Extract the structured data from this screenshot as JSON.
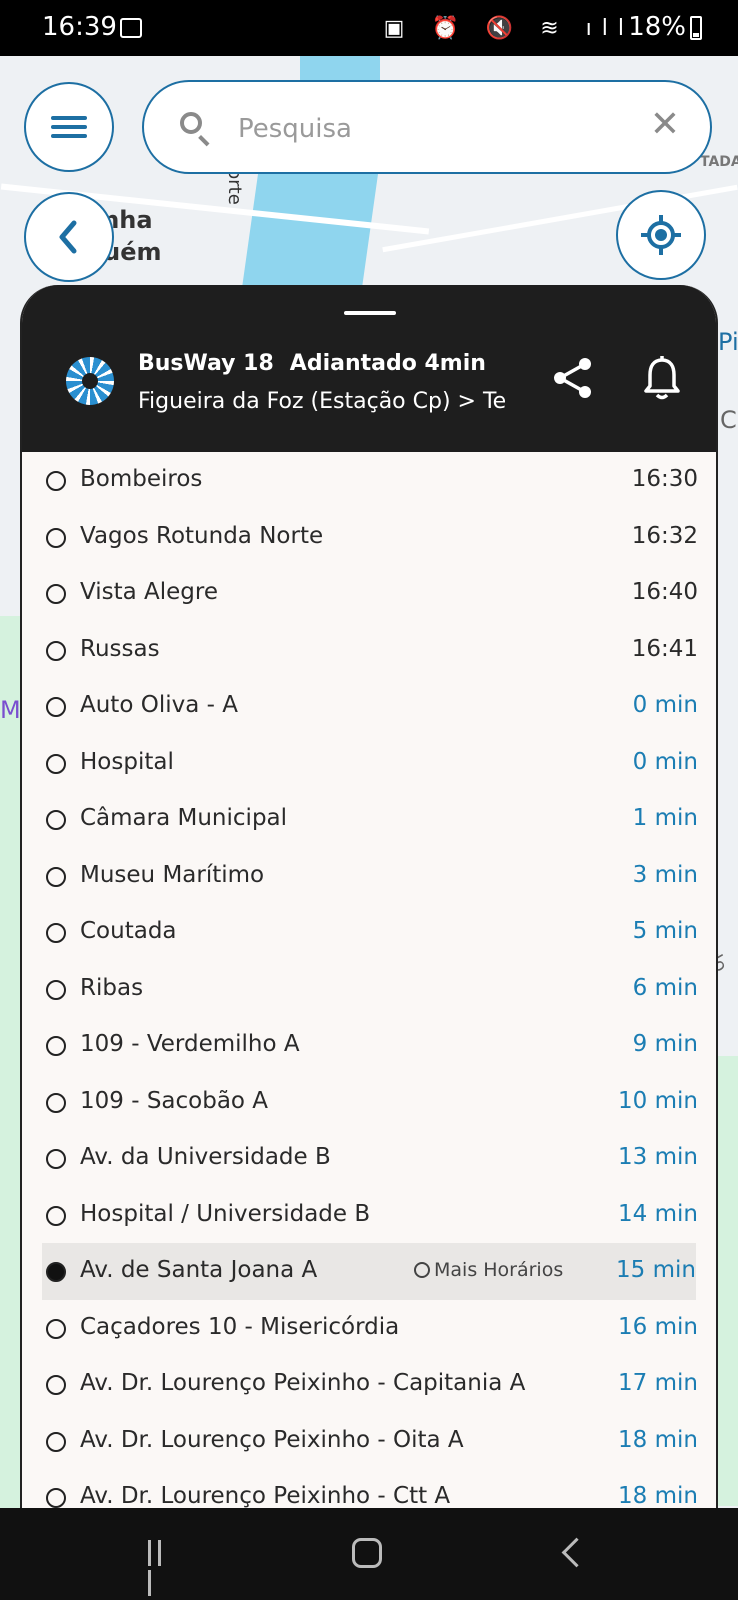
{
  "status_bar": {
    "time": "16:39",
    "icons": "▣ ⏰ 🔇 ≋ ıll",
    "battery": "18%"
  },
  "map": {
    "labels": [
      "anha",
      "quém",
      "orte",
      "TADA",
      "Pi",
      "Cu",
      "M",
      "do Pri"
    ]
  },
  "search": {
    "placeholder": "Pesquisa"
  },
  "line": {
    "name": "BusWay 18",
    "status": "Adiantado 4min",
    "route": "Figueira da Foz (Estação Cp) > Ter"
  },
  "stops": [
    {
      "name": "Bombeiros",
      "time": "16:30",
      "live": false
    },
    {
      "name": "Vagos Rotunda Norte",
      "time": "16:32",
      "live": false
    },
    {
      "name": "Vista Alegre",
      "time": "16:40",
      "live": false
    },
    {
      "name": "Russas",
      "time": "16:41",
      "live": false
    },
    {
      "name": "Auto Oliva - A",
      "time": "0 min",
      "live": true
    },
    {
      "name": "Hospital",
      "time": "0 min",
      "live": true
    },
    {
      "name": "Câmara Municipal",
      "time": "1 min",
      "live": true
    },
    {
      "name": "Museu Marítimo",
      "time": "3 min",
      "live": true
    },
    {
      "name": "Coutada",
      "time": "5 min",
      "live": true
    },
    {
      "name": "Ribas",
      "time": "6 min",
      "live": true
    },
    {
      "name": "109 - Verdemilho A",
      "time": "9 min",
      "live": true
    },
    {
      "name": "109 - Sacobão A",
      "time": "10 min",
      "live": true
    },
    {
      "name": "Av. da Universidade B",
      "time": "13 min",
      "live": true
    },
    {
      "name": "Hospital / Universidade B",
      "time": "14 min",
      "live": true
    },
    {
      "name": "Av. de Santa Joana A",
      "time": "15 min",
      "live": true,
      "selected": true,
      "more_label": "Mais Horários"
    },
    {
      "name": "Caçadores 10 - Misericórdia",
      "time": "16 min",
      "live": true
    },
    {
      "name": "Av. Dr. Lourenço Peixinho - Capitania A",
      "time": "17 min",
      "live": true
    },
    {
      "name": "Av. Dr. Lourenço Peixinho - Oita A",
      "time": "18 min",
      "live": true
    },
    {
      "name": "Av. Dr. Lourenço Peixinho - Ctt A",
      "time": "18 min",
      "live": true
    }
  ],
  "colors": {
    "accent": "#1d6fa3",
    "live_time": "#1b7db3",
    "header_bg": "#1e1e1e"
  }
}
